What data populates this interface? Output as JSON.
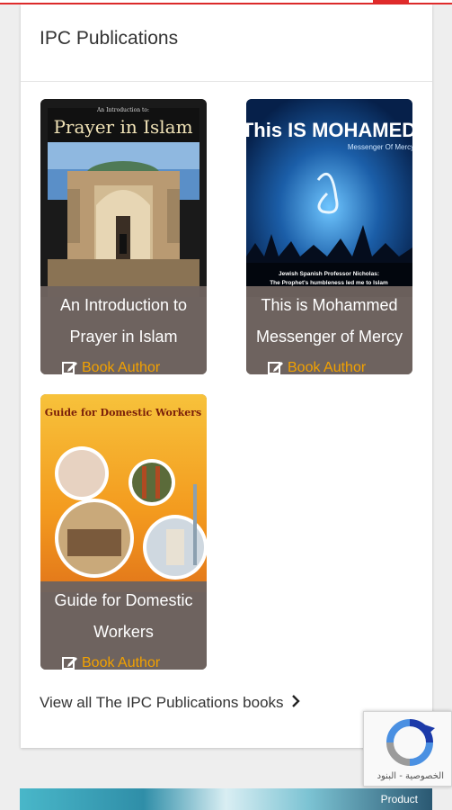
{
  "header": {
    "accent_color": "#e02b2b"
  },
  "section": {
    "title": "IPC Publications"
  },
  "books": [
    {
      "cover_title": "Prayer in Islam",
      "cover_subtitle": "An Introduction to:",
      "title_line1": "An Introduction to",
      "title_line2": "Prayer in Islam",
      "action_label": "Book Author"
    },
    {
      "cover_title": "This IS MOHAMED",
      "cover_subtitle": "Messenger Of Mercy",
      "cover_footer1": "Jewish Spanish Professor Nicholas:",
      "cover_footer2": "The Prophet's humbleness led me to Islam",
      "title_line1": "This is Mohammed",
      "title_line2": "Messenger of Mercy",
      "action_label": "Book Author"
    },
    {
      "cover_title": "Guide for Domestic Workers",
      "title_line1": "Guide for Domestic",
      "title_line2": "Workers",
      "action_label": "Book Author"
    }
  ],
  "view_all": {
    "label": "View all The IPC Publications books"
  },
  "recaptcha": {
    "links": "الخصوصية - البنود"
  },
  "banner": {
    "text": "Product"
  },
  "colors": {
    "caption_bg": "#6e635f",
    "action_color": "#f2a100"
  }
}
